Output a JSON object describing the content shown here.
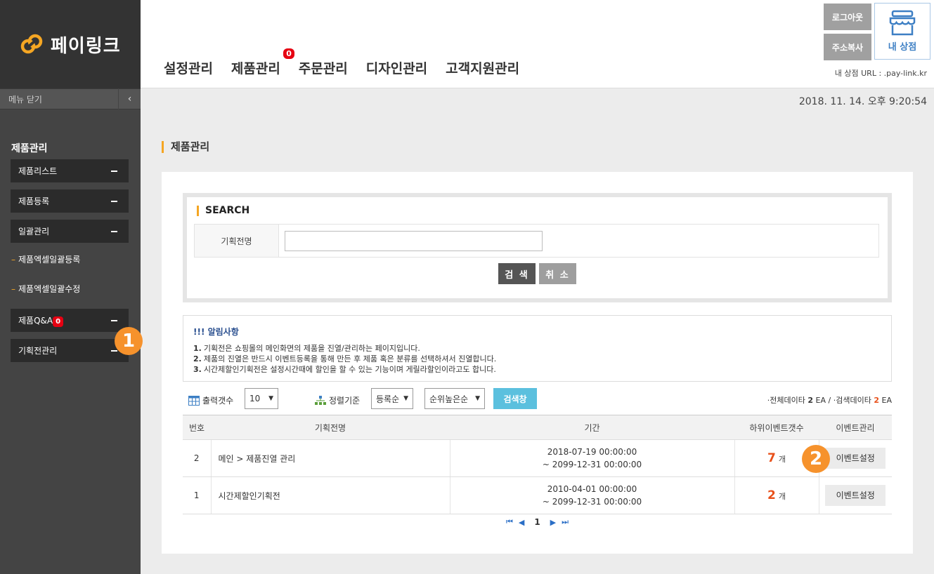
{
  "brand": {
    "name": "페이링크",
    "accent": "#f5a623"
  },
  "sidebar": {
    "menu_close_label": "메뉴 닫기",
    "toggle_icon": "‹",
    "section_title": "제품관리",
    "items": [
      {
        "label": "제품리스트"
      },
      {
        "label": "제품등록"
      },
      {
        "label": "일괄관리"
      },
      {
        "label": "제품엑셀일괄등록"
      },
      {
        "label": "제품엑셀일괄수정"
      },
      {
        "label": "제품Q&A",
        "badge": "0"
      },
      {
        "label": "기획전관리"
      }
    ],
    "step_marker": "1"
  },
  "header": {
    "nav": [
      {
        "label": "설정관리"
      },
      {
        "label": "제품관리",
        "badge": "0"
      },
      {
        "label": "주문관리"
      },
      {
        "label": "디자인관리"
      },
      {
        "label": "고객지원관리"
      }
    ],
    "logout_label": "로그아웃",
    "copy_address_label": "주소복사",
    "my_shop_label": "내 상점",
    "shop_url": "내 상점 URL : .pay-link.kr"
  },
  "datetime": "2018. 11. 14. 오후 9:20:54",
  "page_title": "제품관리",
  "search": {
    "title": "SEARCH",
    "field_label": "기획전명",
    "field_value": "",
    "search_button": "검 색",
    "cancel_button": "취 소"
  },
  "notice": {
    "title": "!!! 알림사항",
    "lines": [
      {
        "num": "1.",
        "text": "기획전은 쇼핑몰의 메인화면의 제품을 진열/관리하는 페이지입니다."
      },
      {
        "num": "2.",
        "text": "제품의 진열은 반드시 이벤트등록을 통해 만든 후 제품 혹은 분류를 선택하셔서 진열합니다."
      },
      {
        "num": "3.",
        "text": "시간제할인기획전은 설정시간때에 할인을 할 수 있는 기능이며 게릴라할인이라고도 합니다."
      }
    ]
  },
  "toolbar": {
    "output_count_label": "출력갯수",
    "output_count_value": "10",
    "sort_label": "정렬기준",
    "sort_value1": "등록순",
    "sort_value2": "순위높은순",
    "search_window_button": "검색창",
    "total_label": "·전체데이타",
    "total_value": "2",
    "unit": "EA",
    "separator": "/",
    "search_total_label": "·검색데이타",
    "search_total_value": "2"
  },
  "table": {
    "headers": [
      "번호",
      "기획전명",
      "기간",
      "하위이벤트갯수",
      "이벤트관리"
    ],
    "rows": [
      {
        "no": "2",
        "name": "메인 > 제품진열 관리",
        "start": "2018-07-19 00:00:00",
        "end": "~ 2099-12-31 00:00:00",
        "count": "7",
        "unit": "개",
        "action": "이벤트설정"
      },
      {
        "no": "1",
        "name": "시간제할인기획전",
        "start": "2010-04-01 00:00:00",
        "end": "~ 2099-12-31 00:00:00",
        "count": "2",
        "unit": "개",
        "action": "이벤트설정"
      }
    ],
    "step_marker": "2"
  },
  "pager": {
    "first": "⏮",
    "prev": "◀",
    "current": "1",
    "next": "▶",
    "last": "⏭"
  }
}
